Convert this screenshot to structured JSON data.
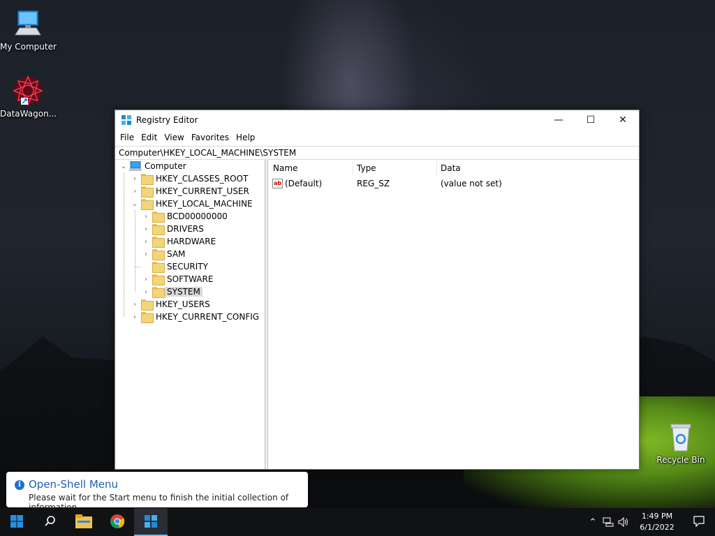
{
  "desktop": {
    "icons": [
      {
        "label": "My Computer"
      },
      {
        "label": "DataWagon..."
      },
      {
        "label": "Recycle Bin"
      }
    ]
  },
  "window": {
    "title": "Registry Editor",
    "controls": {
      "minimize": "—",
      "maximize": "☐",
      "close": "✕"
    },
    "menu": [
      "File",
      "Edit",
      "View",
      "Favorites",
      "Help"
    ],
    "address": "Computer\\HKEY_LOCAL_MACHINE\\SYSTEM",
    "tree": {
      "root": "Computer",
      "items": [
        {
          "label": "HKEY_CLASSES_ROOT",
          "level": 1,
          "expander": "collapsed"
        },
        {
          "label": "HKEY_CURRENT_USER",
          "level": 1,
          "expander": "collapsed"
        },
        {
          "label": "HKEY_LOCAL_MACHINE",
          "level": 1,
          "expander": "expanded"
        },
        {
          "label": "BCD00000000",
          "level": 2,
          "expander": "collapsed"
        },
        {
          "label": "DRIVERS",
          "level": 2,
          "expander": "collapsed"
        },
        {
          "label": "HARDWARE",
          "level": 2,
          "expander": "collapsed"
        },
        {
          "label": "SAM",
          "level": 2,
          "expander": "collapsed"
        },
        {
          "label": "SECURITY",
          "level": 2,
          "expander": "none"
        },
        {
          "label": "SOFTWARE",
          "level": 2,
          "expander": "collapsed"
        },
        {
          "label": "SYSTEM",
          "level": 2,
          "expander": "collapsed",
          "selected": true
        },
        {
          "label": "HKEY_USERS",
          "level": 1,
          "expander": "collapsed"
        },
        {
          "label": "HKEY_CURRENT_CONFIG",
          "level": 1,
          "expander": "collapsed"
        }
      ]
    },
    "list": {
      "columns": [
        "Name",
        "Type",
        "Data"
      ],
      "rows": [
        {
          "name": "(Default)",
          "type": "REG_SZ",
          "data": "(value not set)"
        }
      ]
    }
  },
  "notification": {
    "title": "Open-Shell Menu",
    "message": "Please wait for the Start menu to finish the initial collection of information"
  },
  "taskbar": {
    "clock_time": "1:49 PM",
    "clock_date": "6/1/2022"
  },
  "colors": {
    "accent": "#1e6fd0",
    "folder": "#f4d478",
    "taskbar": "#101214"
  }
}
